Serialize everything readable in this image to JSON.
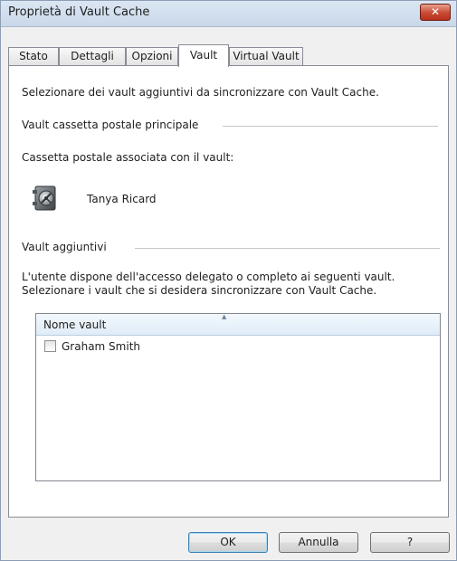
{
  "window": {
    "title": "Proprietà di Vault Cache",
    "close_symbol": "✕"
  },
  "tabs": [
    {
      "label": "Stato",
      "active": false
    },
    {
      "label": "Dettagli",
      "active": false
    },
    {
      "label": "Opzioni",
      "active": false
    },
    {
      "label": "Vault",
      "active": true
    },
    {
      "label": "Virtual Vault",
      "active": false
    }
  ],
  "vault_tab": {
    "intro": "Selezionare dei vault aggiuntivi da sincronizzare con Vault Cache.",
    "primary_group_title": "Vault cassetta postale principale",
    "associated_mailbox_label": "Cassetta postale associata con il vault:",
    "primary_vault_owner": "Tanya Ricard",
    "primary_vault_icon": "vault-safe-icon",
    "additional_group_title": "Vault aggiuntivi",
    "access_line1": "L'utente dispone dell'accesso delegato o completo ai seguenti vault.",
    "access_line2": "Selezionare i vault che si desidera sincronizzare con Vault Cache.",
    "list": {
      "column_header": "Nome vault",
      "sort_indicator": "▲",
      "rows": [
        {
          "name": "Graham Smith",
          "checked": false
        }
      ]
    }
  },
  "buttons": {
    "ok": "OK",
    "cancel": "Annulla",
    "help": "?"
  }
}
